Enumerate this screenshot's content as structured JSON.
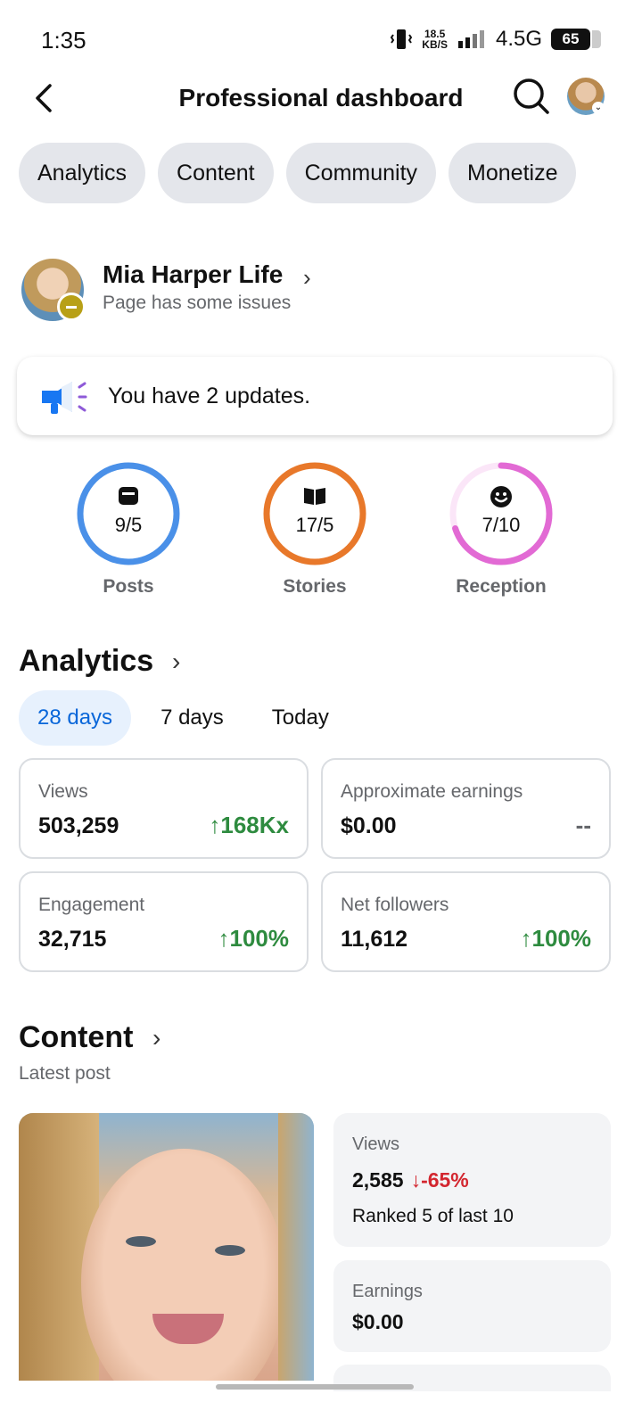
{
  "status_bar": {
    "time": "1:35",
    "speed_value": "18.5",
    "speed_unit": "KB/S",
    "network": "4.5G",
    "battery": "65"
  },
  "header": {
    "title": "Professional dashboard",
    "back_icon": "chevron-left-icon",
    "search_icon": "search-icon"
  },
  "tabs": [
    {
      "label": "Analytics"
    },
    {
      "label": "Content"
    },
    {
      "label": "Community"
    },
    {
      "label": "Monetize"
    }
  ],
  "profile": {
    "name": "Mia Harper Life",
    "status": "Page has some issues",
    "badge_color": "#b8a017"
  },
  "updates": {
    "text": "You have 2 updates.",
    "icon": "megaphone-icon"
  },
  "rings": [
    {
      "value": "9/5",
      "label": "Posts",
      "icon": "post-icon",
      "color": "#4a90e8",
      "fraction": 1.0
    },
    {
      "value": "17/5",
      "label": "Stories",
      "icon": "book-icon",
      "color": "#e8782a",
      "fraction": 1.0
    },
    {
      "value": "7/10",
      "label": "Reception",
      "icon": "smiley-icon",
      "color": "#e26ad4",
      "fraction": 0.7
    }
  ],
  "analytics": {
    "title": "Analytics",
    "ranges": [
      "28 days",
      "7 days",
      "Today"
    ],
    "active_range": "28 days",
    "stats": [
      {
        "label": "Views",
        "value": "503,259",
        "change": "↑168Kx",
        "trend": "up"
      },
      {
        "label": "Approximate earnings",
        "value": "$0.00",
        "change": "--",
        "trend": "neutral"
      },
      {
        "label": "Engagement",
        "value": "32,715",
        "change": "↑100%",
        "trend": "up"
      },
      {
        "label": "Net followers",
        "value": "11,612",
        "change": "↑100%",
        "trend": "up"
      }
    ]
  },
  "content": {
    "title": "Content",
    "subtitle": "Latest post",
    "views_label": "Views",
    "views_value": "2,585",
    "views_change": "↓-65%",
    "rank_text": "Ranked 5 of last 10",
    "earnings_label": "Earnings",
    "earnings_value": "$0.00"
  },
  "colors": {
    "accent": "#0866d9",
    "positive": "#2e8b3f",
    "negative": "#d3262f",
    "chip_bg": "#e4e6eb"
  }
}
